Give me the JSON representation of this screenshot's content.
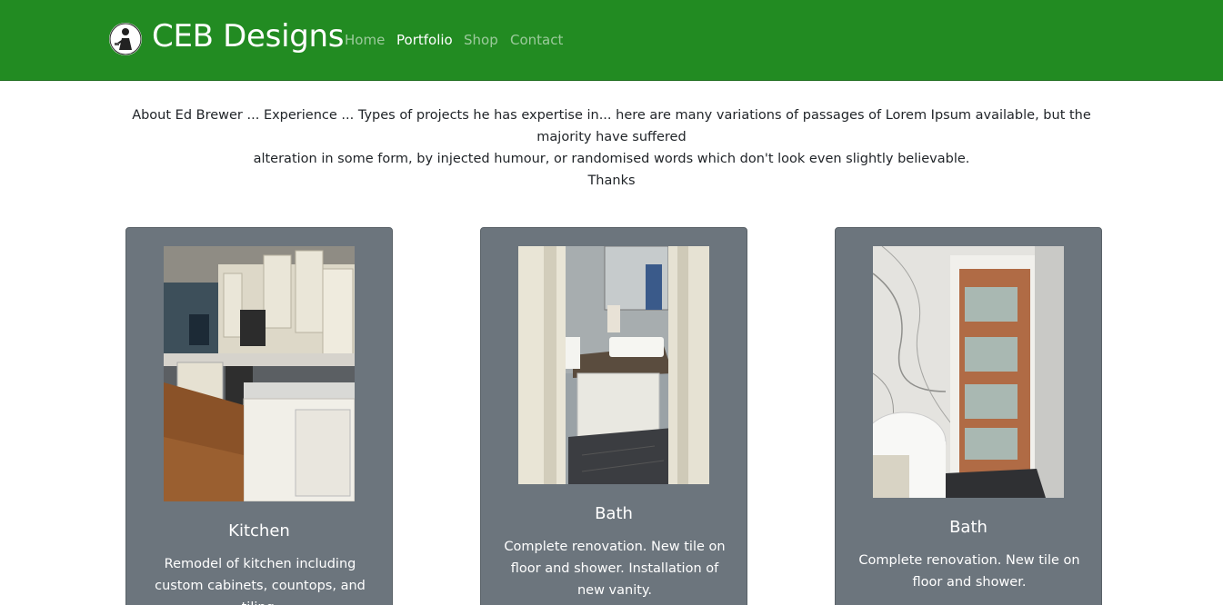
{
  "nav": {
    "brand": "CEB Designs",
    "links": [
      {
        "label": "Home",
        "active": false
      },
      {
        "label": "Portfolio",
        "active": true
      },
      {
        "label": "Shop",
        "active": false
      },
      {
        "label": "Contact",
        "active": false
      }
    ]
  },
  "about": {
    "line1": "About Ed Brewer ... Experience ... Types of projects he has expertise in... here are many variations of passages of Lorem Ipsum available, but the majority have suffered",
    "line2": "alteration in some form, by injected humour, or randomised words which don't look even slightly believable.",
    "line3": "Thanks"
  },
  "cards": [
    {
      "title": "Kitchen",
      "text": "Remodel of kitchen including custom cabinets, countops, and tiling."
    },
    {
      "title": "Bath",
      "text": "Complete renovation. New tile on floor and shower. Installation of new vanity."
    },
    {
      "title": "Bath",
      "text": "Complete renovation. New tile on floor and shower."
    }
  ],
  "colors": {
    "navbar": "#228b22",
    "card": "#6c757d"
  }
}
